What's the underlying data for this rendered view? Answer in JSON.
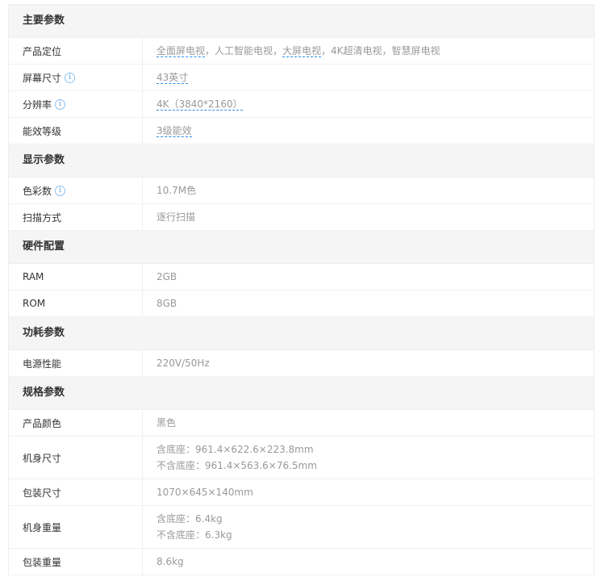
{
  "sections": [
    {
      "title": "主要参数",
      "rows": [
        {
          "label": "产品定位",
          "lines": [
            [
              {
                "text": "全面屏电视",
                "link": true
              },
              {
                "text": "，人工智能电视，"
              },
              {
                "text": "大屏电视",
                "link": true
              },
              {
                "text": "，4K超清电视，智慧屏电视"
              }
            ]
          ]
        },
        {
          "label": "屏幕尺寸",
          "info": true,
          "lines": [
            [
              {
                "text": "43英寸",
                "link": true
              }
            ]
          ]
        },
        {
          "label": "分辨率",
          "info": true,
          "lines": [
            [
              {
                "text": "4K（3840*2160）",
                "link": true
              }
            ]
          ]
        },
        {
          "label": "能效等级",
          "lines": [
            [
              {
                "text": "3级能效",
                "link": true
              }
            ]
          ]
        }
      ]
    },
    {
      "title": "显示参数",
      "rows": [
        {
          "label": "色彩数",
          "info": true,
          "lines": [
            [
              {
                "text": "10.7M色"
              }
            ]
          ]
        },
        {
          "label": "扫描方式",
          "lines": [
            [
              {
                "text": "逐行扫描"
              }
            ]
          ]
        }
      ]
    },
    {
      "title": "硬件配置",
      "rows": [
        {
          "label": "RAM",
          "lines": [
            [
              {
                "text": "2GB"
              }
            ]
          ]
        },
        {
          "label": "ROM",
          "lines": [
            [
              {
                "text": "8GB"
              }
            ]
          ]
        }
      ]
    },
    {
      "title": "功耗参数",
      "rows": [
        {
          "label": "电源性能",
          "lines": [
            [
              {
                "text": "220V/50Hz"
              }
            ]
          ]
        }
      ]
    },
    {
      "title": "规格参数",
      "rows": [
        {
          "label": "产品颜色",
          "lines": [
            [
              {
                "text": "黑色"
              }
            ]
          ]
        },
        {
          "label": "机身尺寸",
          "lines": [
            [
              {
                "text": "含底座：961.4×622.6×223.8mm"
              }
            ],
            [
              {
                "text": "不含底座：961.4×563.6×76.5mm"
              }
            ]
          ]
        },
        {
          "label": "包装尺寸",
          "lines": [
            [
              {
                "text": "1070×645×140mm"
              }
            ]
          ]
        },
        {
          "label": "机身重量",
          "lines": [
            [
              {
                "text": "含底座：6.4kg"
              }
            ],
            [
              {
                "text": "不含底座：6.3kg"
              }
            ]
          ]
        },
        {
          "label": "包装重量",
          "lines": [
            [
              {
                "text": "8.6kg"
              }
            ]
          ]
        }
      ]
    }
  ]
}
